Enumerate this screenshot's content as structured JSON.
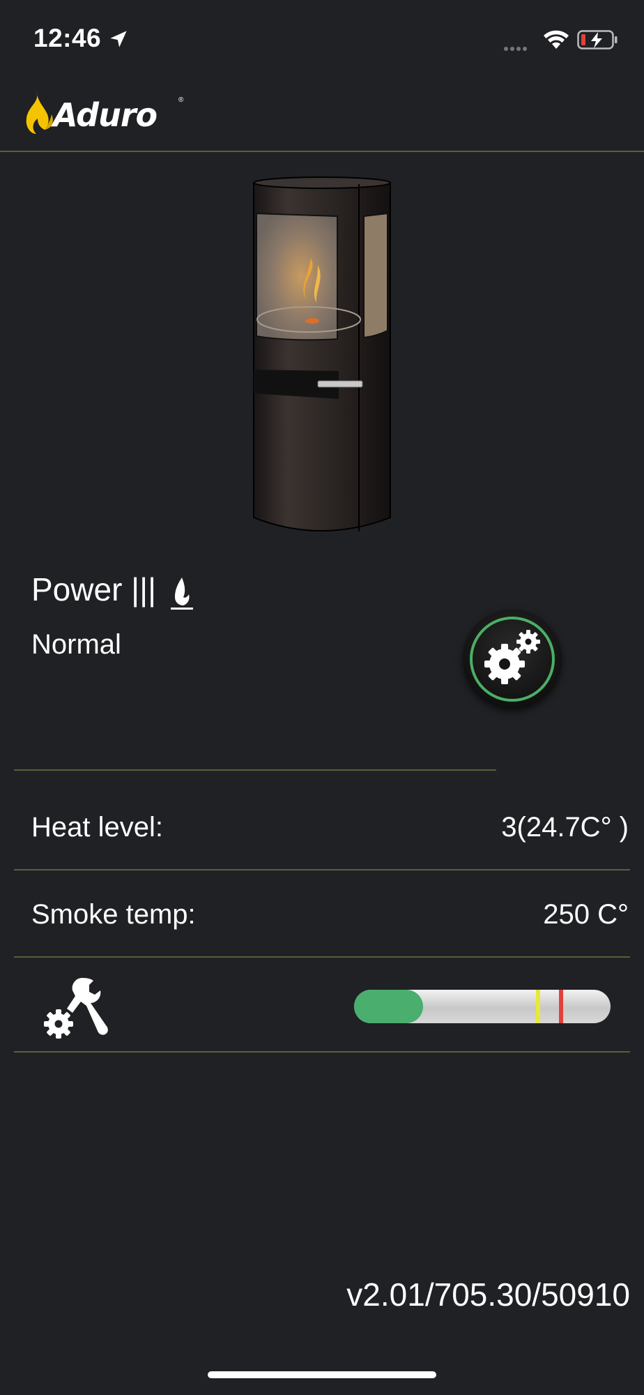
{
  "status_bar": {
    "time": "12:46"
  },
  "header": {
    "brand": "Aduro"
  },
  "stove": {
    "power_label": "Power |||",
    "mode": "Normal"
  },
  "info": {
    "heat_level_label": "Heat level:",
    "heat_level_value": "3(24.7C° )",
    "smoke_temp_label": "Smoke temp:",
    "smoke_temp_value": "250 C°"
  },
  "level_indicator": {
    "fill_fraction": 0.27,
    "markers": [
      {
        "position": 0.71,
        "color": "#e8e83a"
      },
      {
        "position": 0.8,
        "color": "#e0423a"
      }
    ],
    "fill_color": "#4aae6e"
  },
  "footer": {
    "version": "v2.01/705.30/50910"
  },
  "colors": {
    "accent_green": "#4cae66",
    "background": "#202125",
    "divider": "#5d5d37",
    "flame": "#f5c400"
  }
}
